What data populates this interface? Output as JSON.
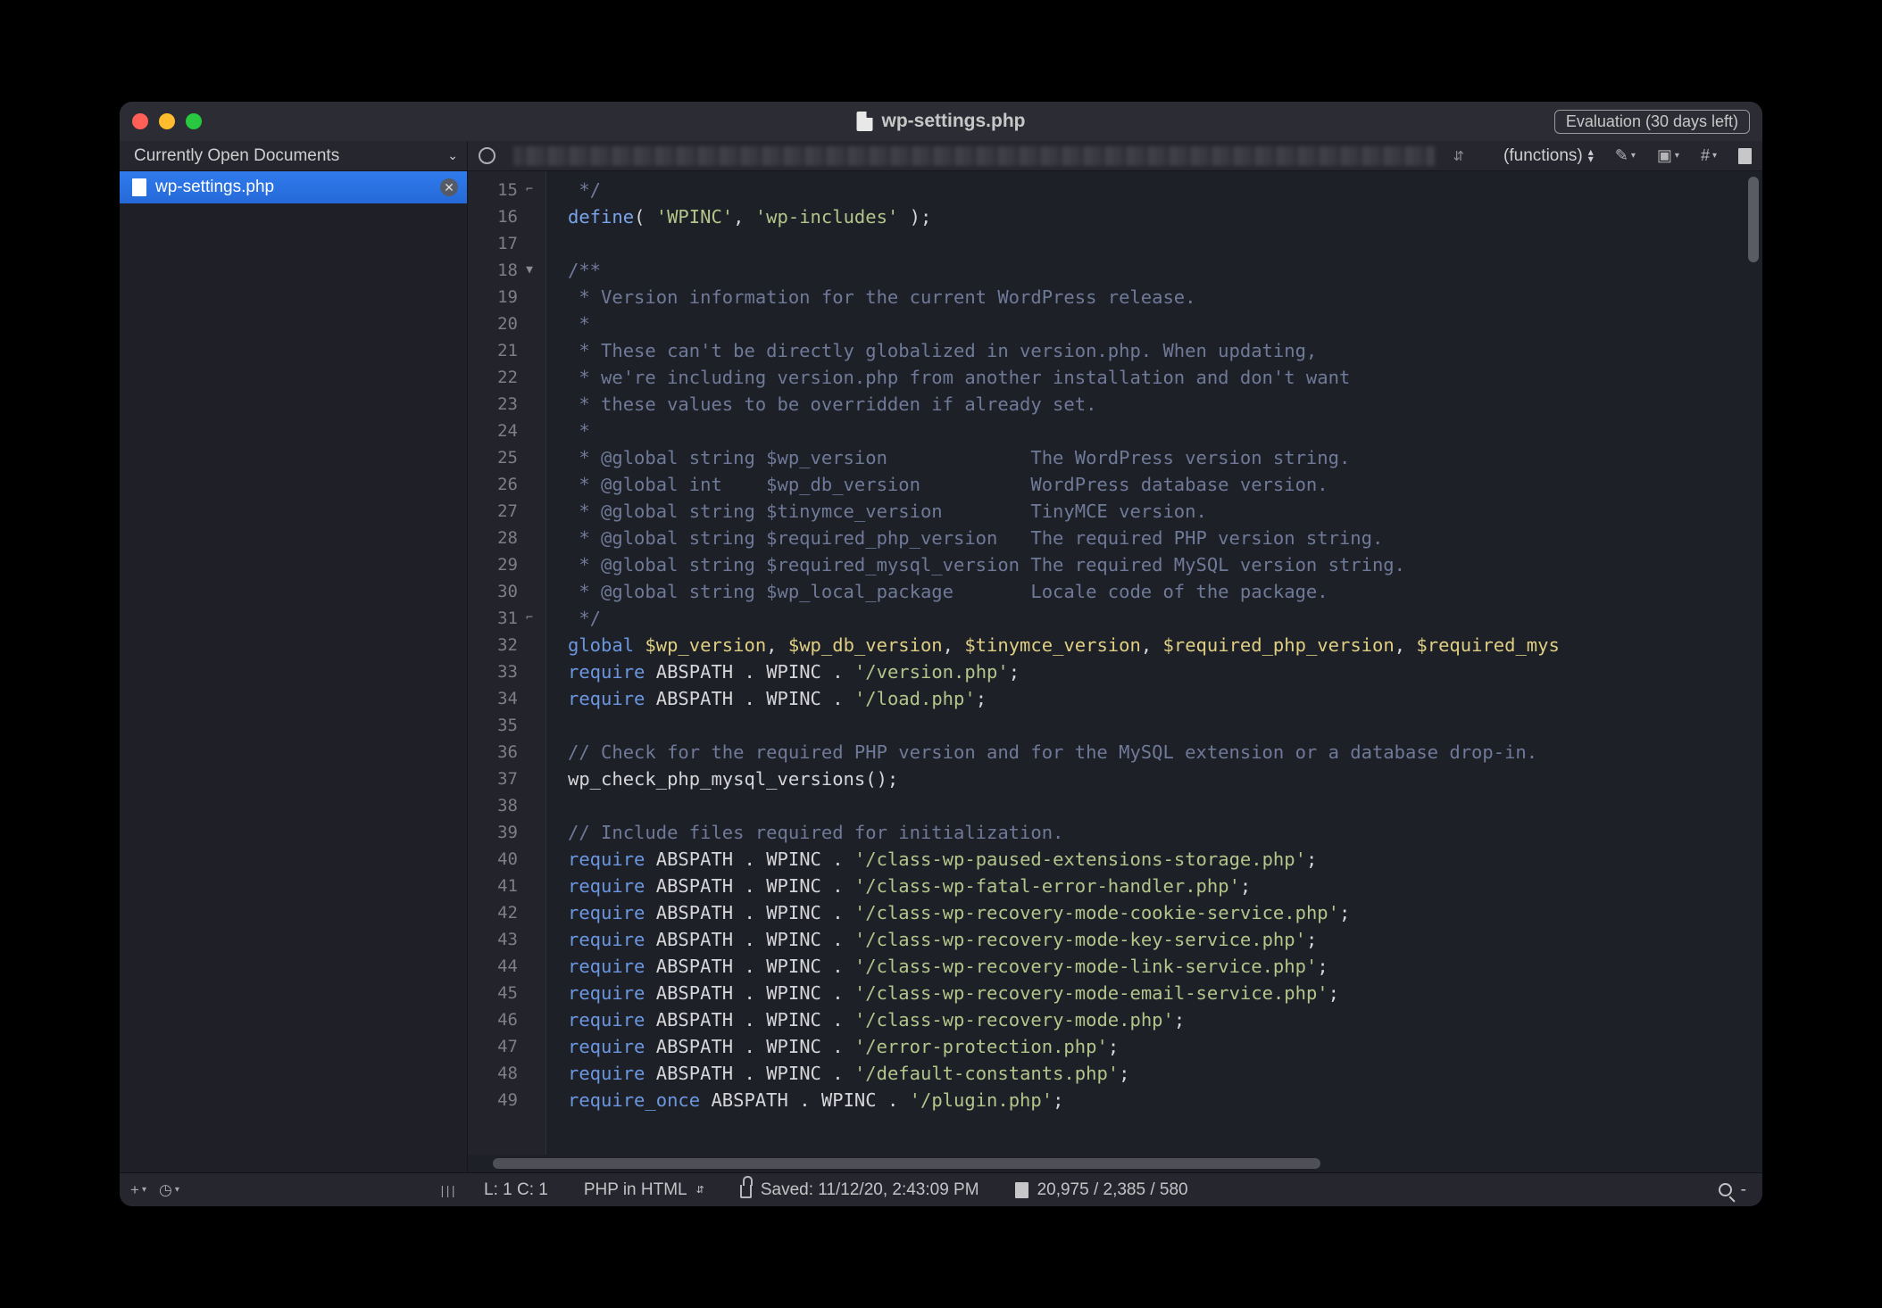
{
  "titlebar": {
    "filename": "wp-settings.php",
    "evaluation": "Evaluation (30 days left)"
  },
  "sidebar_header": "Currently Open Documents",
  "functions_dropdown": "(functions)",
  "open_doc": "wp-settings.php",
  "line_start": 15,
  "gutter_folds": {
    "15": "⌐",
    "18": "▼",
    "31": "⌐"
  },
  "code_lines": [
    [
      [
        "cm",
        " */"
      ]
    ],
    [
      [
        "fn",
        "define"
      ],
      [
        "op",
        "( "
      ],
      [
        "st",
        "'WPINC'"
      ],
      [
        "op",
        ", "
      ],
      [
        "st",
        "'wp-includes'"
      ],
      [
        "op",
        " );"
      ]
    ],
    [],
    [
      [
        "cm",
        "/**"
      ]
    ],
    [
      [
        "cm",
        " * Version information for the current WordPress release."
      ]
    ],
    [
      [
        "cm",
        " *"
      ]
    ],
    [
      [
        "cm",
        " * These can't be directly globalized in version.php. When updating,"
      ]
    ],
    [
      [
        "cm",
        " * we're including version.php from another installation and don't want"
      ]
    ],
    [
      [
        "cm",
        " * these values to be overridden if already set."
      ]
    ],
    [
      [
        "cm",
        " *"
      ]
    ],
    [
      [
        "cm",
        " * @global string $wp_version             The WordPress version string."
      ]
    ],
    [
      [
        "cm",
        " * @global int    $wp_db_version          WordPress database version."
      ]
    ],
    [
      [
        "cm",
        " * @global string $tinymce_version        TinyMCE version."
      ]
    ],
    [
      [
        "cm",
        " * @global string $required_php_version   The required PHP version string."
      ]
    ],
    [
      [
        "cm",
        " * @global string $required_mysql_version The required MySQL version string."
      ]
    ],
    [
      [
        "cm",
        " * @global string $wp_local_package       Locale code of the package."
      ]
    ],
    [
      [
        "cm",
        " */"
      ]
    ],
    [
      [
        "kw",
        "global"
      ],
      [
        "op",
        " "
      ],
      [
        "va",
        "$wp_version"
      ],
      [
        "op",
        ", "
      ],
      [
        "va",
        "$wp_db_version"
      ],
      [
        "op",
        ", "
      ],
      [
        "va",
        "$tinymce_version"
      ],
      [
        "op",
        ", "
      ],
      [
        "va",
        "$required_php_version"
      ],
      [
        "op",
        ", "
      ],
      [
        "va",
        "$required_mys"
      ]
    ],
    [
      [
        "kw",
        "require"
      ],
      [
        "op",
        " "
      ],
      [
        "id",
        "ABSPATH "
      ],
      [
        "op",
        ". "
      ],
      [
        "id",
        "WPINC "
      ],
      [
        "op",
        ". "
      ],
      [
        "st",
        "'/version.php'"
      ],
      [
        "op",
        ";"
      ]
    ],
    [
      [
        "kw",
        "require"
      ],
      [
        "op",
        " "
      ],
      [
        "id",
        "ABSPATH "
      ],
      [
        "op",
        ". "
      ],
      [
        "id",
        "WPINC "
      ],
      [
        "op",
        ". "
      ],
      [
        "st",
        "'/load.php'"
      ],
      [
        "op",
        ";"
      ]
    ],
    [],
    [
      [
        "cm",
        "// Check for the required PHP version and for the MySQL extension or a database drop-in."
      ]
    ],
    [
      [
        "id",
        "wp_check_php_mysql_versions"
      ],
      [
        "op",
        "();"
      ]
    ],
    [],
    [
      [
        "cm",
        "// Include files required for initialization."
      ]
    ],
    [
      [
        "kw",
        "require"
      ],
      [
        "op",
        " "
      ],
      [
        "id",
        "ABSPATH "
      ],
      [
        "op",
        ". "
      ],
      [
        "id",
        "WPINC "
      ],
      [
        "op",
        ". "
      ],
      [
        "st",
        "'/class-wp-paused-extensions-storage.php'"
      ],
      [
        "op",
        ";"
      ]
    ],
    [
      [
        "kw",
        "require"
      ],
      [
        "op",
        " "
      ],
      [
        "id",
        "ABSPATH "
      ],
      [
        "op",
        ". "
      ],
      [
        "id",
        "WPINC "
      ],
      [
        "op",
        ". "
      ],
      [
        "st",
        "'/class-wp-fatal-error-handler.php'"
      ],
      [
        "op",
        ";"
      ]
    ],
    [
      [
        "kw",
        "require"
      ],
      [
        "op",
        " "
      ],
      [
        "id",
        "ABSPATH "
      ],
      [
        "op",
        ". "
      ],
      [
        "id",
        "WPINC "
      ],
      [
        "op",
        ". "
      ],
      [
        "st",
        "'/class-wp-recovery-mode-cookie-service.php'"
      ],
      [
        "op",
        ";"
      ]
    ],
    [
      [
        "kw",
        "require"
      ],
      [
        "op",
        " "
      ],
      [
        "id",
        "ABSPATH "
      ],
      [
        "op",
        ". "
      ],
      [
        "id",
        "WPINC "
      ],
      [
        "op",
        ". "
      ],
      [
        "st",
        "'/class-wp-recovery-mode-key-service.php'"
      ],
      [
        "op",
        ";"
      ]
    ],
    [
      [
        "kw",
        "require"
      ],
      [
        "op",
        " "
      ],
      [
        "id",
        "ABSPATH "
      ],
      [
        "op",
        ". "
      ],
      [
        "id",
        "WPINC "
      ],
      [
        "op",
        ". "
      ],
      [
        "st",
        "'/class-wp-recovery-mode-link-service.php'"
      ],
      [
        "op",
        ";"
      ]
    ],
    [
      [
        "kw",
        "require"
      ],
      [
        "op",
        " "
      ],
      [
        "id",
        "ABSPATH "
      ],
      [
        "op",
        ". "
      ],
      [
        "id",
        "WPINC "
      ],
      [
        "op",
        ". "
      ],
      [
        "st",
        "'/class-wp-recovery-mode-email-service.php'"
      ],
      [
        "op",
        ";"
      ]
    ],
    [
      [
        "kw",
        "require"
      ],
      [
        "op",
        " "
      ],
      [
        "id",
        "ABSPATH "
      ],
      [
        "op",
        ". "
      ],
      [
        "id",
        "WPINC "
      ],
      [
        "op",
        ". "
      ],
      [
        "st",
        "'/class-wp-recovery-mode.php'"
      ],
      [
        "op",
        ";"
      ]
    ],
    [
      [
        "kw",
        "require"
      ],
      [
        "op",
        " "
      ],
      [
        "id",
        "ABSPATH "
      ],
      [
        "op",
        ". "
      ],
      [
        "id",
        "WPINC "
      ],
      [
        "op",
        ". "
      ],
      [
        "st",
        "'/error-protection.php'"
      ],
      [
        "op",
        ";"
      ]
    ],
    [
      [
        "kw",
        "require"
      ],
      [
        "op",
        " "
      ],
      [
        "id",
        "ABSPATH "
      ],
      [
        "op",
        ". "
      ],
      [
        "id",
        "WPINC "
      ],
      [
        "op",
        ". "
      ],
      [
        "st",
        "'/default-constants.php'"
      ],
      [
        "op",
        ";"
      ]
    ],
    [
      [
        "kw",
        "require_once"
      ],
      [
        "op",
        " "
      ],
      [
        "id",
        "ABSPATH "
      ],
      [
        "op",
        ". "
      ],
      [
        "id",
        "WPINC "
      ],
      [
        "op",
        ". "
      ],
      [
        "st",
        "'/plugin.php'"
      ],
      [
        "op",
        ";"
      ]
    ]
  ],
  "status": {
    "cursor": "L: 1 C: 1",
    "language": "PHP in HTML",
    "saved": "Saved: 11/12/20, 2:43:09 PM",
    "counts": "20,975 / 2,385 / 580",
    "search": "-"
  }
}
